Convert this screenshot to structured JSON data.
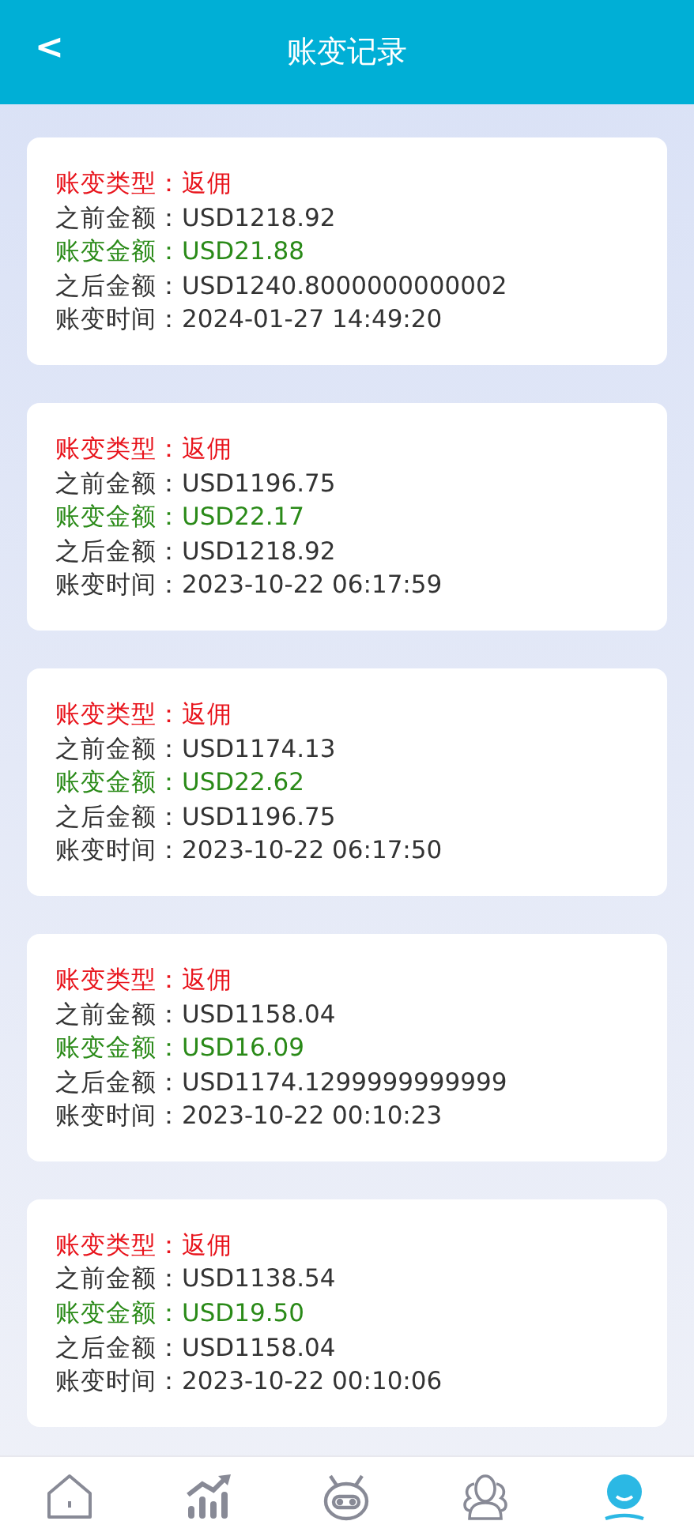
{
  "header": {
    "title": "账变记录",
    "back": "<"
  },
  "records": [
    {
      "lines": [
        {
          "kind": "type",
          "label": "账变类型：",
          "value": "返佣"
        },
        {
          "kind": "plain",
          "label": "之前金额：",
          "value": "USD1218.92"
        },
        {
          "kind": "amount",
          "label": "账变金额：",
          "value": "USD21.88"
        },
        {
          "kind": "plain",
          "label": "之后金额：",
          "value": "USD1240.8000000000002"
        },
        {
          "kind": "plain",
          "label": "账变时间：",
          "value": "2024-01-27 14:49:20"
        }
      ]
    },
    {
      "lines": [
        {
          "kind": "type",
          "label": "账变类型：",
          "value": "返佣"
        },
        {
          "kind": "plain",
          "label": "之前金额：",
          "value": "USD1196.75"
        },
        {
          "kind": "amount",
          "label": "账变金额：",
          "value": "USD22.17"
        },
        {
          "kind": "plain",
          "label": "之后金额：",
          "value": "USD1218.92"
        },
        {
          "kind": "plain",
          "label": "账变时间：",
          "value": "2023-10-22 06:17:59"
        }
      ]
    },
    {
      "lines": [
        {
          "kind": "type",
          "label": "账变类型：",
          "value": "返佣"
        },
        {
          "kind": "plain",
          "label": "之前金额：",
          "value": "USD1174.13"
        },
        {
          "kind": "amount",
          "label": "账变金额：",
          "value": "USD22.62"
        },
        {
          "kind": "plain",
          "label": "之后金额：",
          "value": "USD1196.75"
        },
        {
          "kind": "plain",
          "label": "账变时间：",
          "value": "2023-10-22 06:17:50"
        }
      ]
    },
    {
      "lines": [
        {
          "kind": "type",
          "label": "账变类型：",
          "value": "返佣"
        },
        {
          "kind": "plain",
          "label": "之前金额：",
          "value": "USD1158.04"
        },
        {
          "kind": "amount",
          "label": "账变金额：",
          "value": "USD16.09"
        },
        {
          "kind": "plain",
          "label": "之后金额：",
          "value": "USD1174.1299999999999"
        },
        {
          "kind": "plain",
          "label": "账变时间：",
          "value": "2023-10-22 00:10:23"
        }
      ]
    },
    {
      "lines": [
        {
          "kind": "type",
          "label": "账变类型：",
          "value": "返佣"
        },
        {
          "kind": "plain",
          "label": "之前金额：",
          "value": "USD1138.54"
        },
        {
          "kind": "amount",
          "label": "账变金额：",
          "value": "USD19.50"
        },
        {
          "kind": "plain",
          "label": "之后金额：",
          "value": "USD1158.04"
        },
        {
          "kind": "plain",
          "label": "账变时间：",
          "value": "2023-10-22 00:10:06"
        }
      ]
    }
  ],
  "nav": [
    {
      "kind": "home",
      "selected": false
    },
    {
      "kind": "market",
      "selected": false
    },
    {
      "kind": "robot",
      "selected": false
    },
    {
      "kind": "team",
      "selected": false
    },
    {
      "kind": "profile",
      "selected": true
    }
  ]
}
